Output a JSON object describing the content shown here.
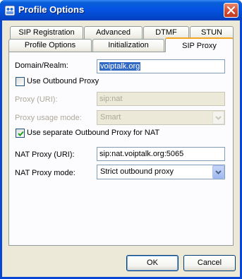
{
  "window": {
    "title": "Profile Options",
    "icon": "app-profile-icon"
  },
  "tabs": {
    "row_top": [
      "SIP Registration",
      "Advanced",
      "DTMF",
      "STUN"
    ],
    "row_bottom": [
      "Profile Options",
      "Initialization",
      "SIP Proxy"
    ],
    "active": "SIP Proxy"
  },
  "form": {
    "domain_label": "Domain/Realm:",
    "domain_value": "voiptalk.org",
    "use_outbound_label": "Use Outbound Proxy",
    "use_outbound_checked": false,
    "proxy_uri_label": "Proxy (URI):",
    "proxy_uri_value": "sip:nat",
    "proxy_mode_label": "Proxy usage mode:",
    "proxy_mode_value": "Smart",
    "separate_nat_label": "Use separate Outbound Proxy for NAT",
    "separate_nat_checked": true,
    "nat_proxy_label": "NAT Proxy (URI):",
    "nat_proxy_value": "sip:nat.voiptalk.org:5065",
    "nat_mode_label": "NAT Proxy mode:",
    "nat_mode_value": "Strict outbound proxy"
  },
  "buttons": {
    "ok": "OK",
    "cancel": "Cancel"
  },
  "colors": {
    "titlebar": "#0554e3",
    "dialog_bg": "#ece9d8",
    "tab_accent": "#f5a623",
    "selection": "#316ac5"
  }
}
